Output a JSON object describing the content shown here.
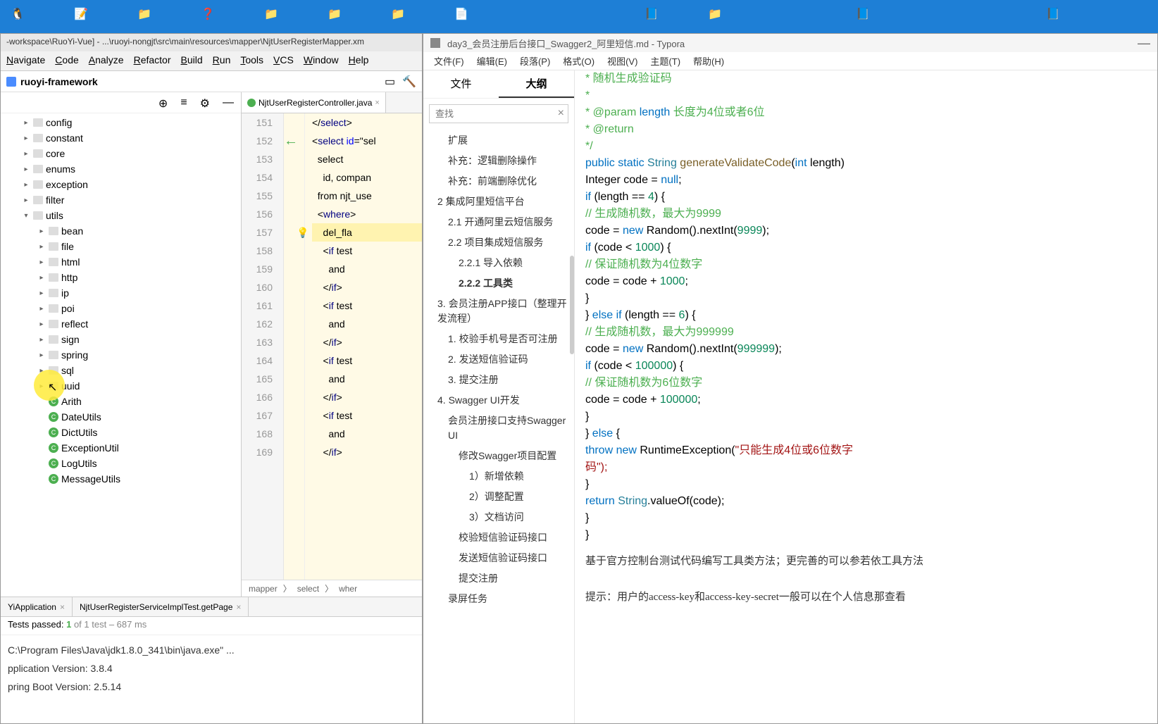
{
  "taskbar": {
    "icons": [
      "penguin",
      "notepad",
      "folder1",
      "help",
      "folder2",
      "folder3",
      "folder4",
      "doc1",
      "doc2",
      "folder5",
      "doc3",
      "doc4"
    ]
  },
  "ide": {
    "titlebar": "-workspace\\RuoYi-Vue] - ...\\ruoyi-nongjt\\src\\main\\resources\\mapper\\NjtUserRegisterMapper.xm",
    "menu": [
      "Navigate",
      "Code",
      "Analyze",
      "Refactor",
      "Build",
      "Run",
      "Tools",
      "VCS",
      "Window",
      "Help"
    ],
    "module": "ruoyi-framework",
    "tree": [
      {
        "indent": 1,
        "icon": "folder",
        "name": "config",
        "chev": "▸"
      },
      {
        "indent": 1,
        "icon": "folder",
        "name": "constant",
        "chev": "▸"
      },
      {
        "indent": 1,
        "icon": "folder",
        "name": "core",
        "chev": "▸"
      },
      {
        "indent": 1,
        "icon": "folder",
        "name": "enums",
        "chev": "▸"
      },
      {
        "indent": 1,
        "icon": "folder",
        "name": "exception",
        "chev": "▸"
      },
      {
        "indent": 1,
        "icon": "folder",
        "name": "filter",
        "chev": "▸"
      },
      {
        "indent": 1,
        "icon": "folder",
        "name": "utils",
        "chev": "▾"
      },
      {
        "indent": 2,
        "icon": "folder",
        "name": "bean",
        "chev": "▸"
      },
      {
        "indent": 2,
        "icon": "folder",
        "name": "file",
        "chev": "▸"
      },
      {
        "indent": 2,
        "icon": "folder",
        "name": "html",
        "chev": "▸"
      },
      {
        "indent": 2,
        "icon": "folder",
        "name": "http",
        "chev": "▸"
      },
      {
        "indent": 2,
        "icon": "folder",
        "name": "ip",
        "chev": "▸"
      },
      {
        "indent": 2,
        "icon": "folder",
        "name": "poi",
        "chev": "▸"
      },
      {
        "indent": 2,
        "icon": "folder",
        "name": "reflect",
        "chev": "▸"
      },
      {
        "indent": 2,
        "icon": "folder",
        "name": "sign",
        "chev": "▸"
      },
      {
        "indent": 2,
        "icon": "folder",
        "name": "spring",
        "chev": "▸"
      },
      {
        "indent": 2,
        "icon": "folder",
        "name": "sql",
        "chev": "▸"
      },
      {
        "indent": 2,
        "icon": "folder",
        "name": "uuid",
        "chev": "▸"
      },
      {
        "indent": 2,
        "icon": "class",
        "name": "Arith"
      },
      {
        "indent": 2,
        "icon": "class",
        "name": "DateUtils"
      },
      {
        "indent": 2,
        "icon": "class",
        "name": "DictUtils"
      },
      {
        "indent": 2,
        "icon": "class",
        "name": "ExceptionUtil"
      },
      {
        "indent": 2,
        "icon": "class",
        "name": "LogUtils"
      },
      {
        "indent": 2,
        "icon": "class",
        "name": "MessageUtils"
      }
    ],
    "editor": {
      "tab1": "NjtUserRegisterController.java",
      "lines": [
        151,
        152,
        153,
        154,
        155,
        156,
        157,
        158,
        159,
        160,
        161,
        162,
        163,
        164,
        165,
        166,
        167,
        168,
        169
      ],
      "code": [
        "</select>",
        "<select id=\"sel",
        "  select",
        "    id, compan",
        "  from njt_use",
        "  <where>",
        "    del_fla",
        "    <if test",
        "      and ",
        "    </if>",
        "    <if test",
        "      and ",
        "    </if>",
        "    <if test",
        "      and ",
        "    </if>",
        "    <if test",
        "      and ",
        "    </if>"
      ],
      "breadcrumb": [
        "mapper",
        "select",
        "wher"
      ]
    },
    "runTabs": [
      "YiApplication",
      "NjtUserRegisterServiceImplTest.getPage"
    ],
    "testStatus": {
      "prefix": "Tests passed: ",
      "pass": "1",
      "suffix": " of 1 test – 687 ms"
    },
    "console": [
      "C:\\Program Files\\Java\\jdk1.8.0_341\\bin\\java.exe\" ...",
      "pplication Version: 3.8.4",
      "pring Boot Version: 2.5.14"
    ]
  },
  "typora": {
    "title": "day3_会员注册后台接口_Swagger2_阿里短信.md - Typora",
    "menu": [
      "文件(F)",
      "编辑(E)",
      "段落(P)",
      "格式(O)",
      "视图(V)",
      "主题(T)",
      "帮助(H)"
    ],
    "tabs": {
      "file": "文件",
      "outline": "大纲"
    },
    "searchPlaceholder": "查找",
    "outline": [
      {
        "l": 2,
        "t": "扩展"
      },
      {
        "l": 2,
        "t": "补充：逻辑删除操作"
      },
      {
        "l": 2,
        "t": "补充：前端删除优化"
      },
      {
        "l": 1,
        "t": "2 集成阿里短信平台"
      },
      {
        "l": 2,
        "t": "2.1 开通阿里云短信服务"
      },
      {
        "l": 2,
        "t": "2.2 项目集成短信服务"
      },
      {
        "l": 3,
        "t": "2.2.1 导入依赖"
      },
      {
        "l": 3,
        "t": "2.2.2 工具类",
        "bold": true
      },
      {
        "l": 1,
        "t": "3. 会员注册APP接口（整理开发流程）"
      },
      {
        "l": 2,
        "t": "1. 校验手机号是否可注册"
      },
      {
        "l": 2,
        "t": "2. 发送短信验证码"
      },
      {
        "l": 2,
        "t": "3. 提交注册"
      },
      {
        "l": 1,
        "t": "4. Swagger UI开发"
      },
      {
        "l": 2,
        "t": "会员注册接口支持Swagger UI"
      },
      {
        "l": 3,
        "t": "修改Swagger项目配置"
      },
      {
        "l": 4,
        "t": "1）新增依赖"
      },
      {
        "l": 4,
        "t": "2）调整配置"
      },
      {
        "l": 4,
        "t": "3）文档访问"
      },
      {
        "l": 3,
        "t": "校验短信验证码接口"
      },
      {
        "l": 3,
        "t": "发送短信验证码接口"
      },
      {
        "l": 3,
        "t": "提交注册"
      },
      {
        "l": 2,
        "t": "录屏任务"
      }
    ],
    "code": {
      "c1": " *  随机生成验证码",
      "c2": " *",
      "c3a": " * @param ",
      "c3b": "length",
      "c3c": "  长度为4位或者6位",
      "c4": " * @return",
      "c5": " */",
      "sig1": "public static ",
      "sig2": "String ",
      "sig3": "generateValidateCode",
      "sig4": "(",
      "sig5": "int ",
      "sig6": "length)",
      "l1a": "    Integer ",
      "l1b": "code = ",
      "l1c": "null",
      "l2a": "    if ",
      "l2b": "(length == ",
      "l2c": "4",
      "l2d": ") {",
      "l3a": "        // ",
      "l3b": "生成随机数，最大为9999",
      "l4a": "        code = ",
      "l4b": "new ",
      "l4c": "Random().nextInt(",
      "l4d": "9999",
      "l4e": ");",
      "l5a": "        if ",
      "l5b": "(code < ",
      "l5c": "1000",
      "l5d": ") {",
      "l6a": "            // ",
      "l6b": "保证随机数为4位数字",
      "l7a": "            code = code + ",
      "l7b": "1000",
      "l7c": ";",
      "l8": "        }",
      "l9a": "    } ",
      "l9b": "else if ",
      "l9c": "(length == ",
      "l9d": "6",
      "l9e": ") {",
      "l10a": "        // ",
      "l10b": "生成随机数，最大为999999",
      "l11a": "        code = ",
      "l11b": "new ",
      "l11c": "Random().nextInt(",
      "l11d": "999999",
      "l11e": ");",
      "l12a": "        if ",
      "l12b": "(code < ",
      "l12c": "100000",
      "l12d": ") {",
      "l13a": "            // ",
      "l13b": "保证随机数为6位数字",
      "l14a": "            code = code + ",
      "l14b": "100000",
      "l14c": ";",
      "l15": "        }",
      "l16a": "    } ",
      "l16b": "else ",
      "l16c": "{",
      "l17a": "        throw new ",
      "l17b": "RuntimeException(",
      "l17c": "\"只能生成4位或6位数字",
      "l17d": "码\");",
      "l18": "    }",
      "l19a": "    return ",
      "l19b": "String",
      "l19c": ".valueOf(code);",
      "l20": "}",
      "l21": "}"
    },
    "text1": "基于官方控制台测试代码编写工具类方法；更完善的可以参若依工具方法",
    "text2": "提示：用户的access-key和access-key-secret一般可以在个人信息那查看"
  }
}
